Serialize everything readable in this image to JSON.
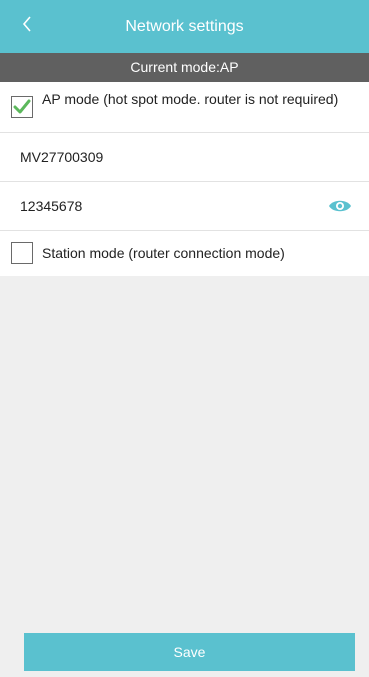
{
  "header": {
    "title": "Network settings",
    "back_icon": "chevron-left-icon",
    "accent_color": "#5ac1cf"
  },
  "mode_bar": {
    "text": "Current mode:AP"
  },
  "ap_mode": {
    "label": "AP mode (hot spot mode. router is not required)",
    "checked": true,
    "ssid": "MV27700309",
    "password": "12345678",
    "password_toggle_icon": "eye-icon"
  },
  "station_mode": {
    "label": "Station mode (router connection mode)",
    "checked": false
  },
  "footer": {
    "save_label": "Save"
  }
}
